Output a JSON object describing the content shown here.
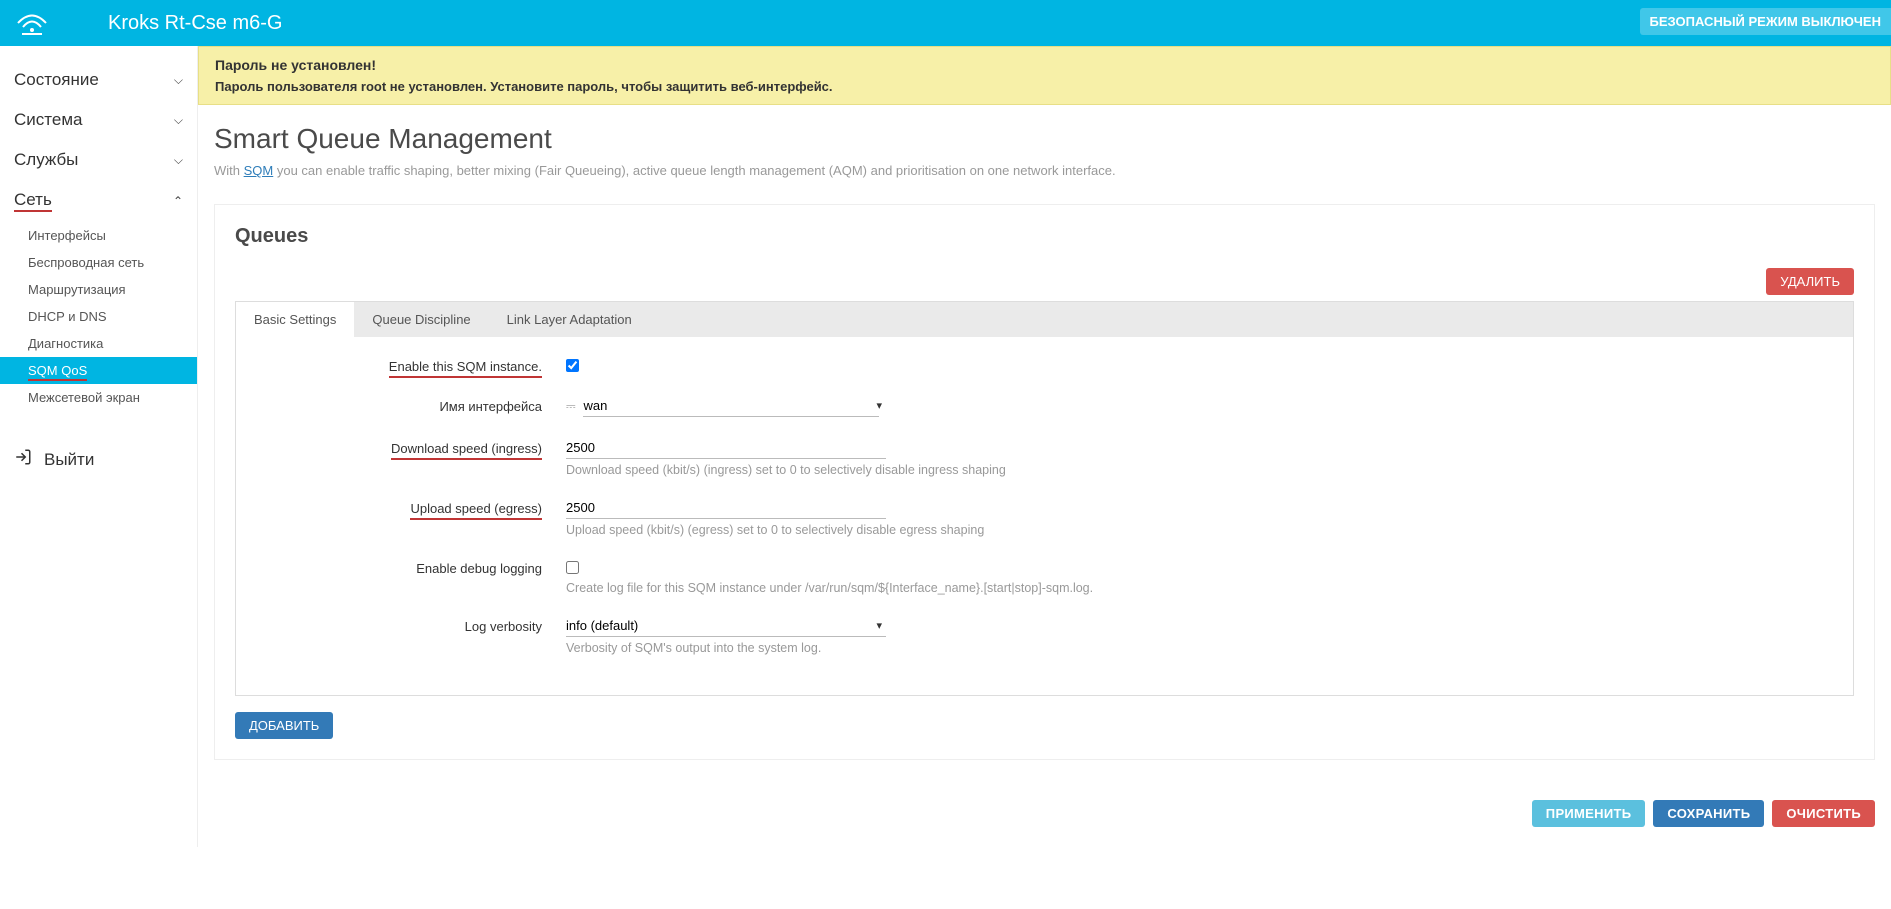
{
  "header": {
    "title": "Kroks Rt-Cse m6-G",
    "safe_mode": "БЕЗОПАСНЫЙ РЕЖИМ ВЫКЛЮЧЕН"
  },
  "sidebar": {
    "groups": [
      {
        "label": "Состояние",
        "expanded": false
      },
      {
        "label": "Система",
        "expanded": false
      },
      {
        "label": "Службы",
        "expanded": false
      },
      {
        "label": "Сеть",
        "expanded": true
      }
    ],
    "net_items": [
      {
        "label": "Интерфейсы"
      },
      {
        "label": "Беспроводная сеть"
      },
      {
        "label": "Маршрутизация"
      },
      {
        "label": "DHCP и DNS"
      },
      {
        "label": "Диагностика"
      },
      {
        "label": "SQM QoS"
      },
      {
        "label": "Межсетевой экран"
      }
    ],
    "logout": "Выйти"
  },
  "warning": {
    "title": "Пароль не установлен!",
    "body": "Пароль пользователя root не установлен. Установите пароль, чтобы защитить веб-интерфейс."
  },
  "page": {
    "title": "Smart Queue Management",
    "desc_prefix": "With ",
    "desc_link": "SQM",
    "desc_suffix": " you can enable traffic shaping, better mixing (Fair Queueing), active queue length management (AQM) and prioritisation on one network interface."
  },
  "section": {
    "title": "Queues",
    "delete": "УДАЛИТЬ",
    "add": "ДОБАВИТЬ"
  },
  "tabs": {
    "basic": "Basic Settings",
    "discipline": "Queue Discipline",
    "linklayer": "Link Layer Adaptation"
  },
  "form": {
    "enable_label": "Enable this SQM instance.",
    "iface_label": "Имя интерфейса",
    "iface_value": "wan",
    "dl_label": "Download speed (ingress)",
    "dl_value": "2500",
    "dl_help": "Download speed (kbit/s) (ingress) set to 0 to selectively disable ingress shaping",
    "ul_label": "Upload speed (egress)",
    "ul_value": "2500",
    "ul_help": "Upload speed (kbit/s) (egress) set to 0 to selectively disable egress shaping",
    "debug_label": "Enable debug logging",
    "debug_help": "Create log file for this SQM instance under /var/run/sqm/${Interface_name}.[start|stop]-sqm.log.",
    "verbosity_label": "Log verbosity",
    "verbosity_value": "info (default)",
    "verbosity_help": "Verbosity of SQM's output into the system log."
  },
  "footer": {
    "apply": "ПРИМЕНИТЬ",
    "save": "СОХРАНИТЬ",
    "reset": "ОЧИСТИТЬ"
  }
}
